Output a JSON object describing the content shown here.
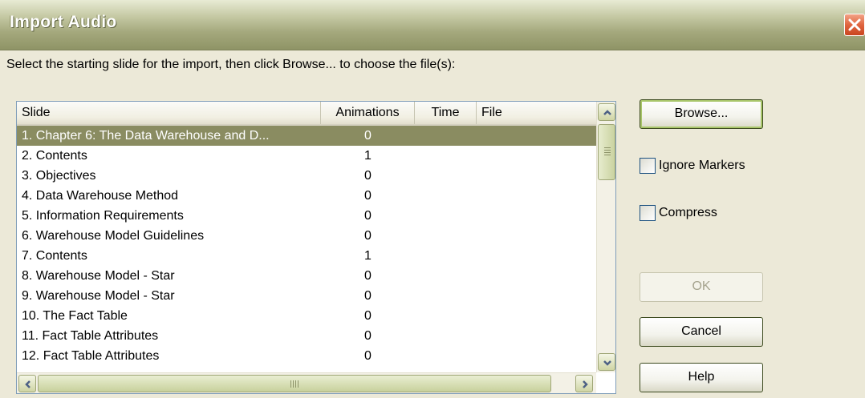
{
  "window": {
    "title": "Import Audio"
  },
  "instruction": "Select the starting slide for the import, then click Browse... to choose the file(s):",
  "columns": {
    "slide": "Slide",
    "animations": "Animations",
    "time": "Time",
    "file": "File"
  },
  "rows": [
    {
      "slide": "1. Chapter 6: The Data Warehouse and D...",
      "animations": "0",
      "time": "",
      "file": "",
      "selected": true
    },
    {
      "slide": "2. Contents",
      "animations": "1",
      "time": "",
      "file": ""
    },
    {
      "slide": "3. Objectives",
      "animations": "0",
      "time": "",
      "file": ""
    },
    {
      "slide": "4. Data Warehouse Method",
      "animations": "0",
      "time": "",
      "file": ""
    },
    {
      "slide": "5. Information Requirements",
      "animations": "0",
      "time": "",
      "file": ""
    },
    {
      "slide": "6. Warehouse Model Guidelines",
      "animations": "0",
      "time": "",
      "file": ""
    },
    {
      "slide": "7. Contents",
      "animations": "1",
      "time": "",
      "file": ""
    },
    {
      "slide": "8. Warehouse Model - Star",
      "animations": "0",
      "time": "",
      "file": ""
    },
    {
      "slide": "9. Warehouse Model - Star",
      "animations": "0",
      "time": "",
      "file": ""
    },
    {
      "slide": "10. The Fact Table",
      "animations": "0",
      "time": "",
      "file": ""
    },
    {
      "slide": "11. Fact Table Attributes",
      "animations": "0",
      "time": "",
      "file": ""
    },
    {
      "slide": "12. Fact Table Attributes",
      "animations": "0",
      "time": "",
      "file": ""
    }
  ],
  "buttons": {
    "browse": "Browse...",
    "ok": "OK",
    "cancel": "Cancel",
    "help": "Help"
  },
  "options": {
    "ignore_markers": {
      "label": "Ignore Markers",
      "checked": false
    },
    "compress": {
      "label": "Compress",
      "checked": false
    }
  },
  "icons": {
    "close": "close-icon",
    "scroll_up": "arrow-up-icon",
    "scroll_down": "arrow-down-icon",
    "scroll_left": "arrow-left-icon",
    "scroll_right": "arrow-right-icon"
  },
  "colors": {
    "selection": "#8a8c61",
    "titlebar": "#a4a87c",
    "close": "#e0653f"
  }
}
